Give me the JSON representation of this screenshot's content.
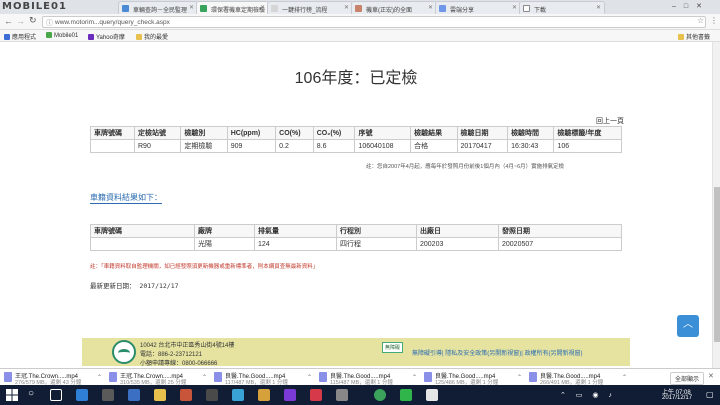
{
  "tabs": [
    {
      "label": "MOBILE01",
      "active": false
    },
    {
      "label": "車輛查詢－全民監理",
      "active": false
    },
    {
      "label": "環保署機車定期檢驗",
      "active": true
    },
    {
      "label": "一鍵排行榜_流程",
      "active": false
    },
    {
      "label": "機車(正宏)的全面",
      "active": false
    },
    {
      "label": "雲端分享",
      "active": false
    },
    {
      "label": "下載",
      "active": false
    }
  ],
  "address": {
    "url": "www.motorim...query/query_check.aspx"
  },
  "bookmarks": [
    {
      "label": "應用程式",
      "icon": "apps-icon"
    },
    {
      "label": "Mobile01",
      "icon": "mobile01-icon"
    },
    {
      "label": "Yahoo奇摩",
      "icon": "yahoo-icon"
    },
    {
      "label": "我的最愛",
      "icon": "folder-icon"
    },
    {
      "label": "其他書籤",
      "icon": "folder-icon"
    }
  ],
  "page": {
    "title": "106年度：已定檢",
    "back_link": "回上一頁",
    "inspection_table": {
      "headers": [
        "車牌號碼",
        "定檢站號",
        "檢驗別",
        "HC(ppm)",
        "CO(%)",
        "CO₂(%)",
        "序號",
        "檢驗結果",
        "檢驗日期",
        "檢驗時間",
        "檢驗標籤/年度"
      ],
      "rows": [
        [
          "",
          "R90",
          "定期檢驗",
          "909",
          "0.2",
          "8.6",
          "106040108",
          "合格",
          "20170417",
          "16:30:43",
          "106"
        ]
      ]
    },
    "inspection_note": "註：您自2007年4月起，應每年於發照月份前後1個月內（4月~6月）實施排氣定檢",
    "registry_heading": "車籍資料結果如下：",
    "registry_table": {
      "headers": [
        "車牌號碼",
        "廠牌",
        "排氣量",
        "行程別",
        "出廠日",
        "發照日期"
      ],
      "rows": [
        [
          "",
          "光陽",
          "124",
          "四行程",
          "200203",
          "20020507"
        ]
      ]
    },
    "registry_note": "註：「車籍資料取自監理機關，如已經發照須更新機器或重新標準者，則本網頁查無最新資料」",
    "last_updated": "最新更新日期： 2017/12/17"
  },
  "footer": {
    "address_line": "10042 台北市中正區秀山街4號14樓",
    "phone_line": "電話：886-2-23712121",
    "service_line": "小額申請專線：0800-066666",
    "badge": "無障礙",
    "links": "無障礙引導| 隱私及安全政策(另開新視窗)| 政權所有(另開新視窗)"
  },
  "downloads": [
    {
      "name": "王冠.The.Crown.....mp4",
      "size": "276/579 MB，還剩 43 分鐘"
    },
    {
      "name": "王冠.The.Crown.....mp4",
      "size": "310/535 MB，還剩 25 分鐘"
    },
    {
      "name": "良醫.The.Good.....mp4",
      "size": "117/487 MB，還剩 1 分鐘"
    },
    {
      "name": "良醫.The.Good.....mp4",
      "size": "115/487 MB，還剩 1 分鐘"
    },
    {
      "name": "良醫.The.Good.....mp4",
      "size": "125/486 MB，還剩 1 分鐘"
    },
    {
      "name": "良醫.The.Good.....mp4",
      "size": "266/491 MB，還剩 1 分鐘"
    }
  ],
  "downloads_show_all": "全部顯示",
  "taskbar": {
    "time": "上午 07:08",
    "date": "2017/12/17"
  }
}
